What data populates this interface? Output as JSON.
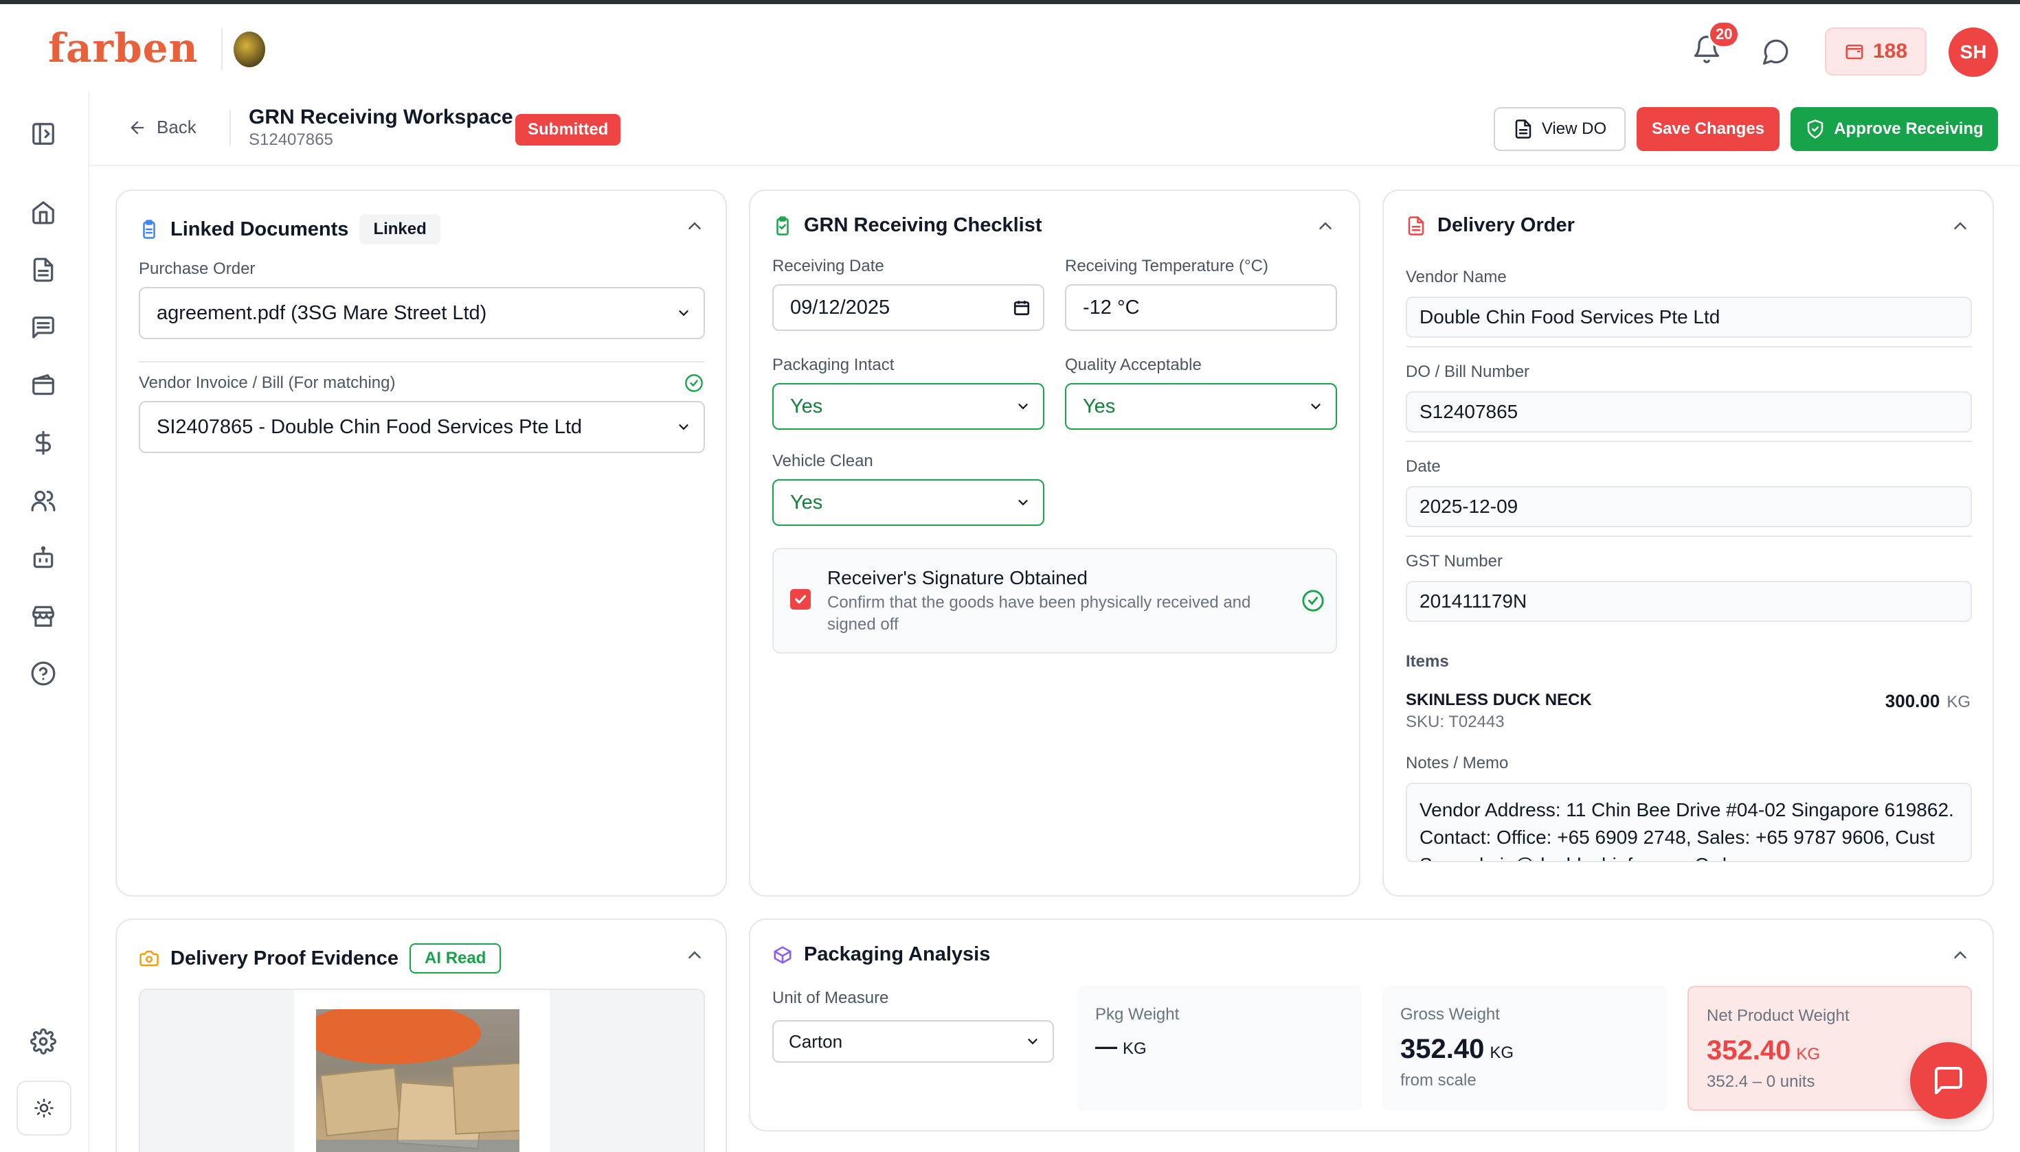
{
  "header": {
    "logo_text": "farben",
    "notification_count": "20",
    "credits": "188",
    "avatar_initials": "SH",
    "accent_color": "#ef4444"
  },
  "sidebar": {
    "icons": [
      "sidebar-toggle-icon",
      "home-icon",
      "document-icon",
      "message-list-icon",
      "wallet-icon",
      "dollar-icon",
      "users-icon",
      "robot-icon",
      "store-icon",
      "help-icon",
      "settings-icon",
      "sun-icon"
    ]
  },
  "subheader": {
    "back_label": "Back",
    "title": "GRN Receiving Workspace",
    "subtitle": "S12407865",
    "status": "Submitted",
    "view_do_label": "View DO",
    "save_label": "Save Changes",
    "approve_label": "Approve Receiving"
  },
  "linked_documents": {
    "title": "Linked Documents",
    "badge": "Linked",
    "po_label": "Purchase Order",
    "po_value": "agreement.pdf (3SG Mare Street Ltd)",
    "invoice_label": "Vendor Invoice / Bill (For matching)",
    "invoice_value": "SI2407865 - Double Chin Food Services Pte Ltd"
  },
  "checklist": {
    "title": "GRN Receiving Checklist",
    "date_label": "Receiving Date",
    "date_value": "09/12/2025",
    "temp_label": "Receiving Temperature (°C)",
    "temp_value": "-12 °C",
    "packaging_label": "Packaging Intact",
    "packaging_value": "Yes",
    "quality_label": "Quality Acceptable",
    "quality_value": "Yes",
    "vehicle_label": "Vehicle Clean",
    "vehicle_value": "Yes",
    "signature_title": "Receiver's Signature Obtained",
    "signature_desc_1": "Confirm that the goods have been physically received and",
    "signature_desc_2": "signed off"
  },
  "delivery_order": {
    "title": "Delivery Order",
    "vendor_label": "Vendor Name",
    "vendor_value": "Double Chin Food Services Pte Ltd",
    "bill_label": "DO / Bill Number",
    "bill_value": "S12407865",
    "date_label": "Date",
    "date_value": "2025-12-09",
    "gst_label": "GST Number",
    "gst_value": "201411179N",
    "items_label": "Items",
    "items": [
      {
        "name": "SKINLESS DUCK NECK",
        "sku": "SKU: T02443",
        "qty": "300.00",
        "unit": "KG"
      }
    ],
    "notes_label": "Notes / Memo",
    "notes_line_1": "Vendor Address: 11 Chin Bee Drive #04-02 Singapore 619862.",
    "notes_line_2": "Contact: Office: +65 6909 2748, Sales: +65 9787 9606, Cust",
    "notes_line_3": "Svc: admin@doublechinfs.com, Order:"
  },
  "evidence": {
    "title": "Delivery Proof Evidence",
    "badge": "AI Read"
  },
  "packaging": {
    "title": "Packaging Analysis",
    "uom_label": "Unit of Measure",
    "uom_value": "Carton",
    "pkg_label": "Pkg Weight",
    "pkg_value": "—",
    "pkg_unit": "KG",
    "gross_label": "Gross Weight",
    "gross_value": "352.40",
    "gross_unit": "KG",
    "gross_sub": "from scale",
    "net_label": "Net Product Weight",
    "net_value": "352.40",
    "net_unit": "KG",
    "net_sub": "352.4 – 0 units"
  }
}
